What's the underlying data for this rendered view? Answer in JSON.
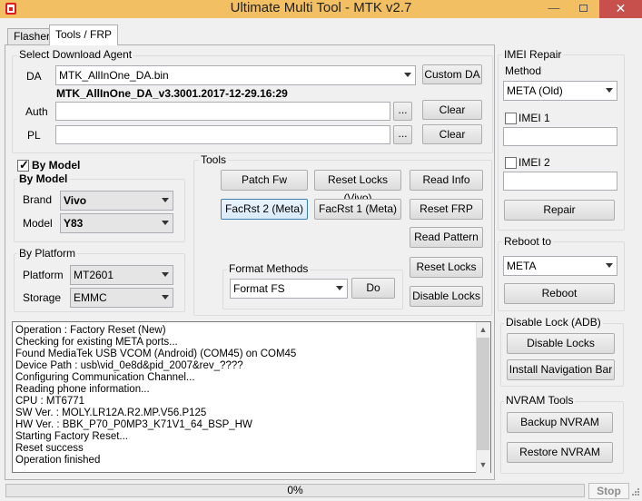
{
  "window": {
    "title": "Ultimate Multi Tool - MTK v2.7",
    "minimize": "—",
    "close": "✕"
  },
  "tabs": [
    {
      "label": "Flasher"
    },
    {
      "label": "Tools / FRP"
    }
  ],
  "download_agent": {
    "group_label": "Select Download Agent",
    "da_label": "DA",
    "da_value": "MTK_AllInOne_DA.bin",
    "custom_da": "Custom DA",
    "da_info": "MTK_AllInOne_DA_v3.3001.2017-12-29.16:29",
    "auth_label": "Auth",
    "auth_value": "",
    "auth_browse": "...",
    "auth_clear": "Clear",
    "pl_label": "PL",
    "pl_value": "",
    "pl_browse": "...",
    "pl_clear": "Clear"
  },
  "by_model": {
    "checkbox_label": "By Model",
    "checked": true,
    "group_label": "By Model",
    "brand_label": "Brand",
    "brand_value": "Vivo",
    "model_label": "Model",
    "model_value": "Y83"
  },
  "by_platform": {
    "group_label": "By Platform",
    "platform_label": "Platform",
    "platform_value": "MT2601",
    "storage_label": "Storage",
    "storage_value": "EMMC"
  },
  "tools": {
    "group_label": "Tools",
    "patch_fw": "Patch Fw",
    "reset_locks_vivo": "Reset Locks (Vivo)",
    "read_info": "Read Info",
    "facrst2": "FacRst 2 (Meta)",
    "facrst1": "FacRst 1 (Meta)",
    "reset_frp": "Reset FRP",
    "read_pattern": "Read Pattern",
    "reset_locks": "Reset Locks",
    "disable_locks": "Disable Locks",
    "format_group_label": "Format Methods",
    "format_value": "Format FS",
    "do": "Do"
  },
  "log": {
    "lines": [
      "Operation : Factory Reset (New)",
      "Checking for existing META ports...",
      "Found MediaTek USB VCOM (Android) (COM45) on COM45",
      "Device Path : usb\\vid_0e8d&pid_2007&rev_????",
      "Configuring Communication Channel...",
      "Reading phone information...",
      "CPU : MT6771",
      "SW Ver. : MOLY.LR12A.R2.MP.V56.P125",
      "HW Ver. : BBK_P70_P0MP3_K71V1_64_BSP_HW",
      "Starting Factory Reset...",
      "Reset success",
      "Operation finished"
    ]
  },
  "imei_repair": {
    "group_label": "IMEI Repair",
    "method_label": "Method",
    "method_value": "META (Old)",
    "imei1_label": "IMEI 1",
    "imei1_value": "",
    "imei2_label": "IMEI 2",
    "imei2_value": "",
    "repair": "Repair"
  },
  "reboot": {
    "group_label": "Reboot to",
    "mode_value": "META",
    "reboot": "Reboot"
  },
  "disable_lock": {
    "group_label": "Disable Lock (ADB)",
    "disable_locks": "Disable Locks",
    "install_nav": "Install Navigation Bar"
  },
  "nvram": {
    "group_label": "NVRAM Tools",
    "backup": "Backup NVRAM",
    "restore": "Restore NVRAM"
  },
  "status": {
    "progress_text": "0%",
    "progress_value": 0,
    "stop": "Stop"
  }
}
